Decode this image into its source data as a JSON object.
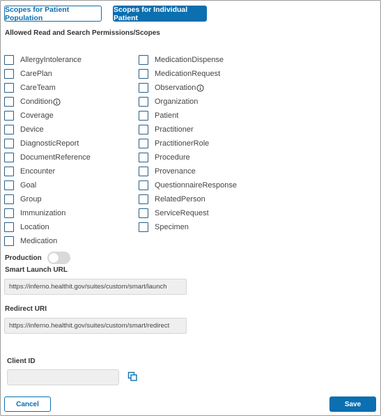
{
  "tabs": {
    "population": "Scopes for Patient Population",
    "individual": "Scopes for Individual Patient"
  },
  "permissions_heading": "Allowed Read and Search Permissions/Scopes",
  "scopes": {
    "left": [
      {
        "label": "AllergyIntolerance",
        "info": false
      },
      {
        "label": "CarePlan",
        "info": false
      },
      {
        "label": "CareTeam",
        "info": false
      },
      {
        "label": "Condition",
        "info": true
      },
      {
        "label": "Coverage",
        "info": false
      },
      {
        "label": "Device",
        "info": false
      },
      {
        "label": "DiagnosticReport",
        "info": false
      },
      {
        "label": "DocumentReference",
        "info": false
      },
      {
        "label": "Encounter",
        "info": false
      },
      {
        "label": "Goal",
        "info": false
      },
      {
        "label": "Group",
        "info": false
      },
      {
        "label": "Immunization",
        "info": false
      },
      {
        "label": "Location",
        "info": false
      },
      {
        "label": "Medication",
        "info": false
      }
    ],
    "right": [
      {
        "label": "MedicationDispense",
        "info": false
      },
      {
        "label": "MedicationRequest",
        "info": false
      },
      {
        "label": "Observation",
        "info": true
      },
      {
        "label": "Organization",
        "info": false
      },
      {
        "label": "Patient",
        "info": false
      },
      {
        "label": "Practitioner",
        "info": false
      },
      {
        "label": "PractitionerRole",
        "info": false
      },
      {
        "label": "Procedure",
        "info": false
      },
      {
        "label": "Provenance",
        "info": false
      },
      {
        "label": "QuestionnaireResponse",
        "info": false
      },
      {
        "label": "RelatedPerson",
        "info": false
      },
      {
        "label": "ServiceRequest",
        "info": false
      },
      {
        "label": "Specimen",
        "info": false
      }
    ]
  },
  "production": {
    "label": "Production",
    "enabled": false
  },
  "smart_launch": {
    "label": "Smart Launch URL",
    "value": "https://inferno.healthit.gov/suites/custom/smart/launch"
  },
  "redirect": {
    "label": "Redirect URI",
    "value": "https://inferno.healthit.gov/suites/custom/smart/redirect"
  },
  "client_id": {
    "label": "Client ID",
    "value": ""
  },
  "actions": {
    "cancel": "Cancel",
    "save": "Save"
  },
  "colors": {
    "primary": "#0b6fb0",
    "checkbox_border": "#2a5d84",
    "field_bg": "#efefef"
  },
  "icons": {
    "info": "info-circle-icon",
    "copy": "copy-icon"
  }
}
